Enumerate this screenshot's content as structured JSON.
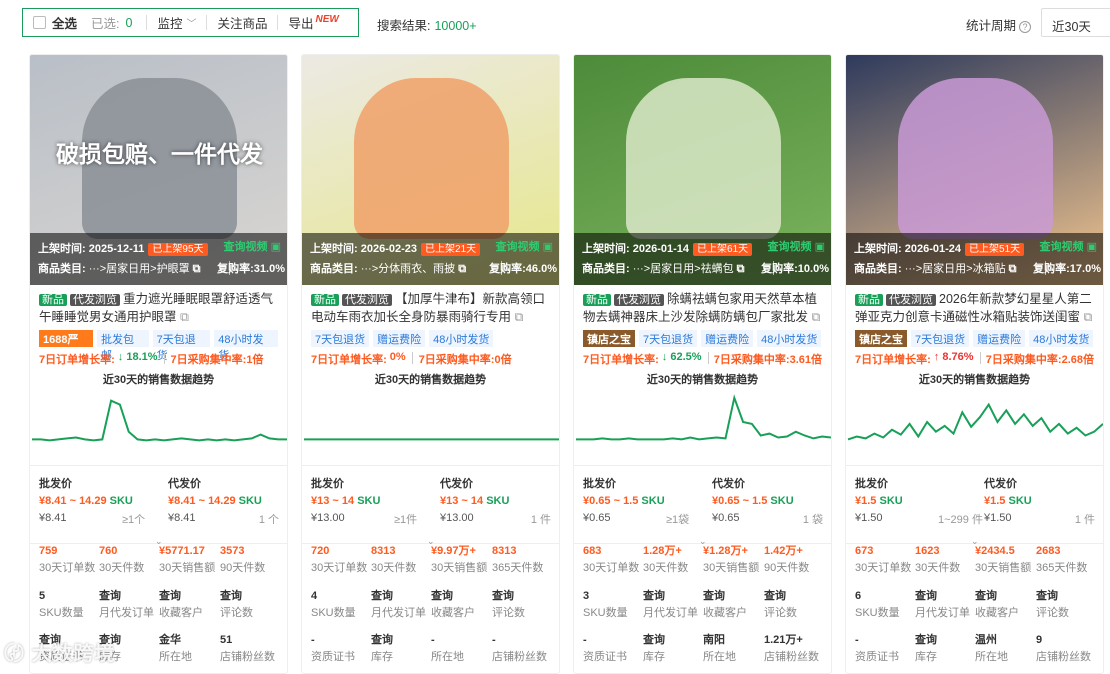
{
  "toolbar": {
    "select_all": "全选",
    "selected_label": "已选:",
    "selected_count": "0",
    "monitor": "监控",
    "follow": "关注商品",
    "export": "导出",
    "export_badge": "NEW"
  },
  "search": {
    "label": "搜索结果:",
    "count": "10000+"
  },
  "period": {
    "label": "统计周期",
    "value": "近30天"
  },
  "watermark": "大数跨境",
  "common": {
    "listed": "上架时间:",
    "category": "商品类目:",
    "video": "查询视频",
    "badge_new": "新品",
    "badge_df": "代发浏览",
    "growth_label": "7日订单增长率:",
    "conc_label": "7日采购集中率:",
    "trend_title": "近30天的销售数据趋势",
    "wholesale": "批发价",
    "dropship": "代发价",
    "sku": "SKU",
    "labels": [
      "30天订单数",
      "30天件数",
      "30天销售额",
      "90天件数",
      "SKU数量",
      "月代发订单",
      "收藏客户",
      "评论数",
      "资质证书",
      "库存",
      "所在地",
      "店铺粉丝数"
    ]
  },
  "cards": [
    {
      "img_text": "破损包赔、一件代发",
      "date": "2025-12-11",
      "days": "已上架95天",
      "category": "···>居家日用>护眼罩",
      "repurchase": "复购率:31.0%",
      "title": "重力遮光睡眠眼罩舒适透气午睡睡觉男女通用护眼罩",
      "tags": [
        {
          "t": "1688严选",
          "c": "yx"
        },
        {
          "t": "批发包邮"
        },
        {
          "t": "7天包退货"
        },
        {
          "t": "48小时发货"
        }
      ],
      "growth": "↓ 18.1%",
      "growth_dir": "dn",
      "conc": "1倍",
      "w_price": "¥8.41 ~ 14.29",
      "w_min": "¥8.41",
      "w_minq": "≥1个",
      "d_price": "¥8.41 ~ 14.29",
      "d_min": "¥8.41",
      "d_minq": "1 个",
      "stats": [
        "759",
        "760",
        "¥5771.17",
        "3573",
        "5",
        "查询",
        "查询",
        "查询",
        "查询",
        "查询",
        "金华",
        "51"
      ],
      "labels3": [
        "30天订单数",
        "30天件数",
        "30天销售额",
        "90天件数"
      ],
      "spark": [
        12,
        12,
        11,
        12,
        13,
        14,
        12,
        11,
        12,
        52,
        48,
        20,
        12,
        11,
        12,
        11,
        12,
        13,
        12,
        11,
        12,
        11,
        12,
        11,
        12,
        13,
        17,
        13,
        12,
        12
      ]
    },
    {
      "img_text": "",
      "date": "2026-02-23",
      "days": "已上架21天",
      "category": "···>分体雨衣、雨披",
      "repurchase": "复购率:46.0%",
      "title": "【加厚牛津布】新款高领口电动车雨衣加长全身防暴雨骑行专用",
      "tags": [
        {
          "t": "7天包退货"
        },
        {
          "t": "赠运费险"
        },
        {
          "t": "48小时发货"
        }
      ],
      "growth": "0%",
      "growth_dir": "",
      "conc": "0倍",
      "w_price": "¥13 ~ 14",
      "w_min": "¥13.00",
      "w_minq": "≥1件",
      "d_price": "¥13 ~ 14",
      "d_min": "¥13.00",
      "d_minq": "1 件",
      "stats": [
        "720",
        "8313",
        "¥9.97万+",
        "8313",
        "4",
        "查询",
        "查询",
        "查询",
        "-",
        "查询",
        "-",
        "-"
      ],
      "labels3": [
        "30天订单数",
        "30天件数",
        "30天销售额",
        "365天件数"
      ],
      "spark": [
        12,
        12,
        12,
        12,
        12,
        12,
        12,
        12,
        12,
        12,
        12,
        12,
        12,
        12,
        12,
        12,
        12,
        12,
        12,
        12,
        12,
        12,
        12,
        12,
        12,
        12,
        12,
        12,
        12,
        12
      ]
    },
    {
      "img_text": "",
      "date": "2026-01-14",
      "days": "已上架61天",
      "category": "···>居家日用>祛螨包",
      "repurchase": "复购率:10.0%",
      "title": "除螨祛螨包家用天然草本植物去螨神器床上沙发除螨防螨包厂家批发",
      "tags": [
        {
          "t": "镇店之宝",
          "c": "zb"
        },
        {
          "t": "7天包退货"
        },
        {
          "t": "赠运费险"
        },
        {
          "t": "48小时发货"
        }
      ],
      "growth": "↓ 62.5%",
      "growth_dir": "dn",
      "conc": "3.61倍",
      "w_price": "¥0.65 ~ 1.5",
      "w_min": "¥0.65",
      "w_minq": "≥1袋",
      "d_price": "¥0.65 ~ 1.5",
      "d_min": "¥0.65",
      "d_minq": "1 袋",
      "stats": [
        "683",
        "1.28万+",
        "¥1.28万+",
        "1.42万+",
        "3",
        "查询",
        "查询",
        "查询",
        "-",
        "查询",
        "南阳",
        "1.21万+"
      ],
      "labels3": [
        "30天订单数",
        "30天件数",
        "30天销售额",
        "90天件数"
      ],
      "spark": [
        12,
        12,
        12,
        13,
        12,
        12,
        13,
        12,
        12,
        12,
        12,
        13,
        12,
        14,
        12,
        13,
        14,
        13,
        55,
        30,
        28,
        16,
        18,
        14,
        15,
        20,
        16,
        13,
        15,
        14
      ]
    },
    {
      "img_text": "",
      "date": "2026-01-24",
      "days": "已上架51天",
      "category": "···>居家日用>冰箱贴",
      "repurchase": "复购率:17.0%",
      "title": "2026年新款梦幻星星人第二弹亚克力创意卡通磁性冰箱贴装饰送闺蜜",
      "tags": [
        {
          "t": "镇店之宝",
          "c": "zb"
        },
        {
          "t": "7天包退货"
        },
        {
          "t": "赠运费险"
        },
        {
          "t": "48小时发货"
        }
      ],
      "growth": "↑ 8.76%",
      "growth_dir": "up",
      "conc": "2.68倍",
      "w_price": "¥1.5",
      "w_min": "¥1.50",
      "w_minq": "1~299 件",
      "d_price": "¥1.5",
      "d_min": "¥1.50",
      "d_minq": "1 件",
      "stats": [
        "673",
        "1623",
        "¥2434.5",
        "2683",
        "6",
        "查询",
        "查询",
        "查询",
        "-",
        "查询",
        "温州",
        "9"
      ],
      "labels3": [
        "30天订单数",
        "30天件数",
        "30天销售额",
        "365天件数"
      ],
      "spark": [
        12,
        15,
        13,
        18,
        14,
        22,
        17,
        28,
        15,
        30,
        20,
        26,
        18,
        40,
        25,
        35,
        48,
        30,
        42,
        28,
        38,
        26,
        34,
        20,
        28,
        18,
        24,
        16,
        20,
        28
      ]
    }
  ]
}
